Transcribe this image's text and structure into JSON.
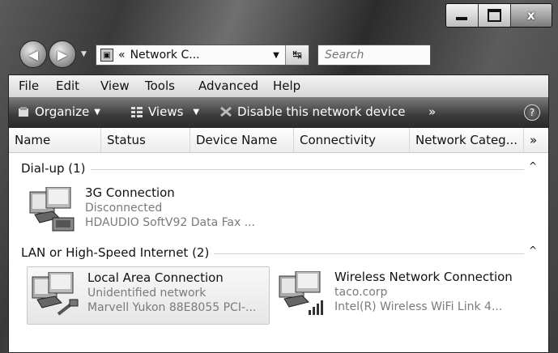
{
  "window": {
    "caption_min": "",
    "caption_max": "",
    "caption_close": "x"
  },
  "navigation": {
    "back_icon": "back-arrow-icon",
    "forward_icon": "forward-arrow-icon",
    "address_prefix": "«",
    "address_text": "Network C...",
    "search_placeholder": "Search"
  },
  "menubar": {
    "items": [
      "File",
      "Edit",
      "View",
      "Tools",
      "Advanced",
      "Help"
    ]
  },
  "commandbar": {
    "organize": "Organize",
    "views": "Views",
    "disable": "Disable this network device",
    "more": "»",
    "help": "?"
  },
  "columns": [
    "Name",
    "Status",
    "Device Name",
    "Connectivity",
    "Network Categ...",
    "»"
  ],
  "groups": [
    {
      "label": "Dial-up (1)",
      "collapse": "^",
      "items": [
        {
          "name": "3G Connection",
          "status": "Disconnected",
          "device": "HDAUDIO SoftV92 Data Fax ...",
          "icon": "modem-connection-icon",
          "selected": false
        }
      ]
    },
    {
      "label": "LAN or High-Speed Internet (2)",
      "collapse": "^",
      "items": [
        {
          "name": "Local Area Connection",
          "status": "Unidentified network",
          "device": "Marvell Yukon 88E8055 PCI-...",
          "icon": "lan-connection-icon",
          "selected": true
        },
        {
          "name": "Wireless Network Connection",
          "status": "taco.corp",
          "device": "Intel(R) Wireless WiFi Link 4...",
          "icon": "wireless-connection-icon",
          "selected": false
        }
      ]
    }
  ]
}
